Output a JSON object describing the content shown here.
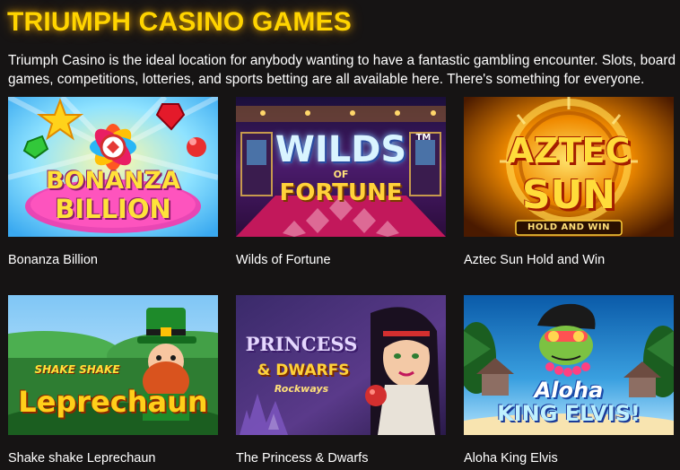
{
  "page": {
    "title": "TRIUMPH CASINO GAMES",
    "intro": "Triumph Casino is the ideal location for anybody wanting to have a fantastic gambling encounter. Slots, board games, competitions, lotteries, and sports betting are all available here. There's something for everyone."
  },
  "games": [
    {
      "name": "Bonanza Billion",
      "logo_line1": "BONANZA",
      "logo_line2": "BILLION"
    },
    {
      "name": "Wilds of Fortune",
      "logo_line1": "WILDS",
      "logo_line2": "OF",
      "logo_line3": "FORTUNE",
      "logo_mark": "TM"
    },
    {
      "name": "Aztec Sun Hold and Win",
      "logo_line1": "AZTEC",
      "logo_line2": "SUN",
      "logo_line3": "HOLD AND WIN"
    },
    {
      "name": "Shake shake Leprechaun",
      "logo_line1": "SHAKE SHAKE",
      "logo_line2": "Leprechaun"
    },
    {
      "name": "The Princess & Dwarfs",
      "logo_line1": "PRINCESS",
      "logo_line2": "& DWARFS",
      "logo_line3": "Rockways"
    },
    {
      "name": "Aloha King Elvis",
      "logo_line1": "Aloha",
      "logo_line2": "KING ELVIS!"
    }
  ],
  "colors": {
    "background": "#161414",
    "title": "#ffd400",
    "text": "#ffffff"
  }
}
